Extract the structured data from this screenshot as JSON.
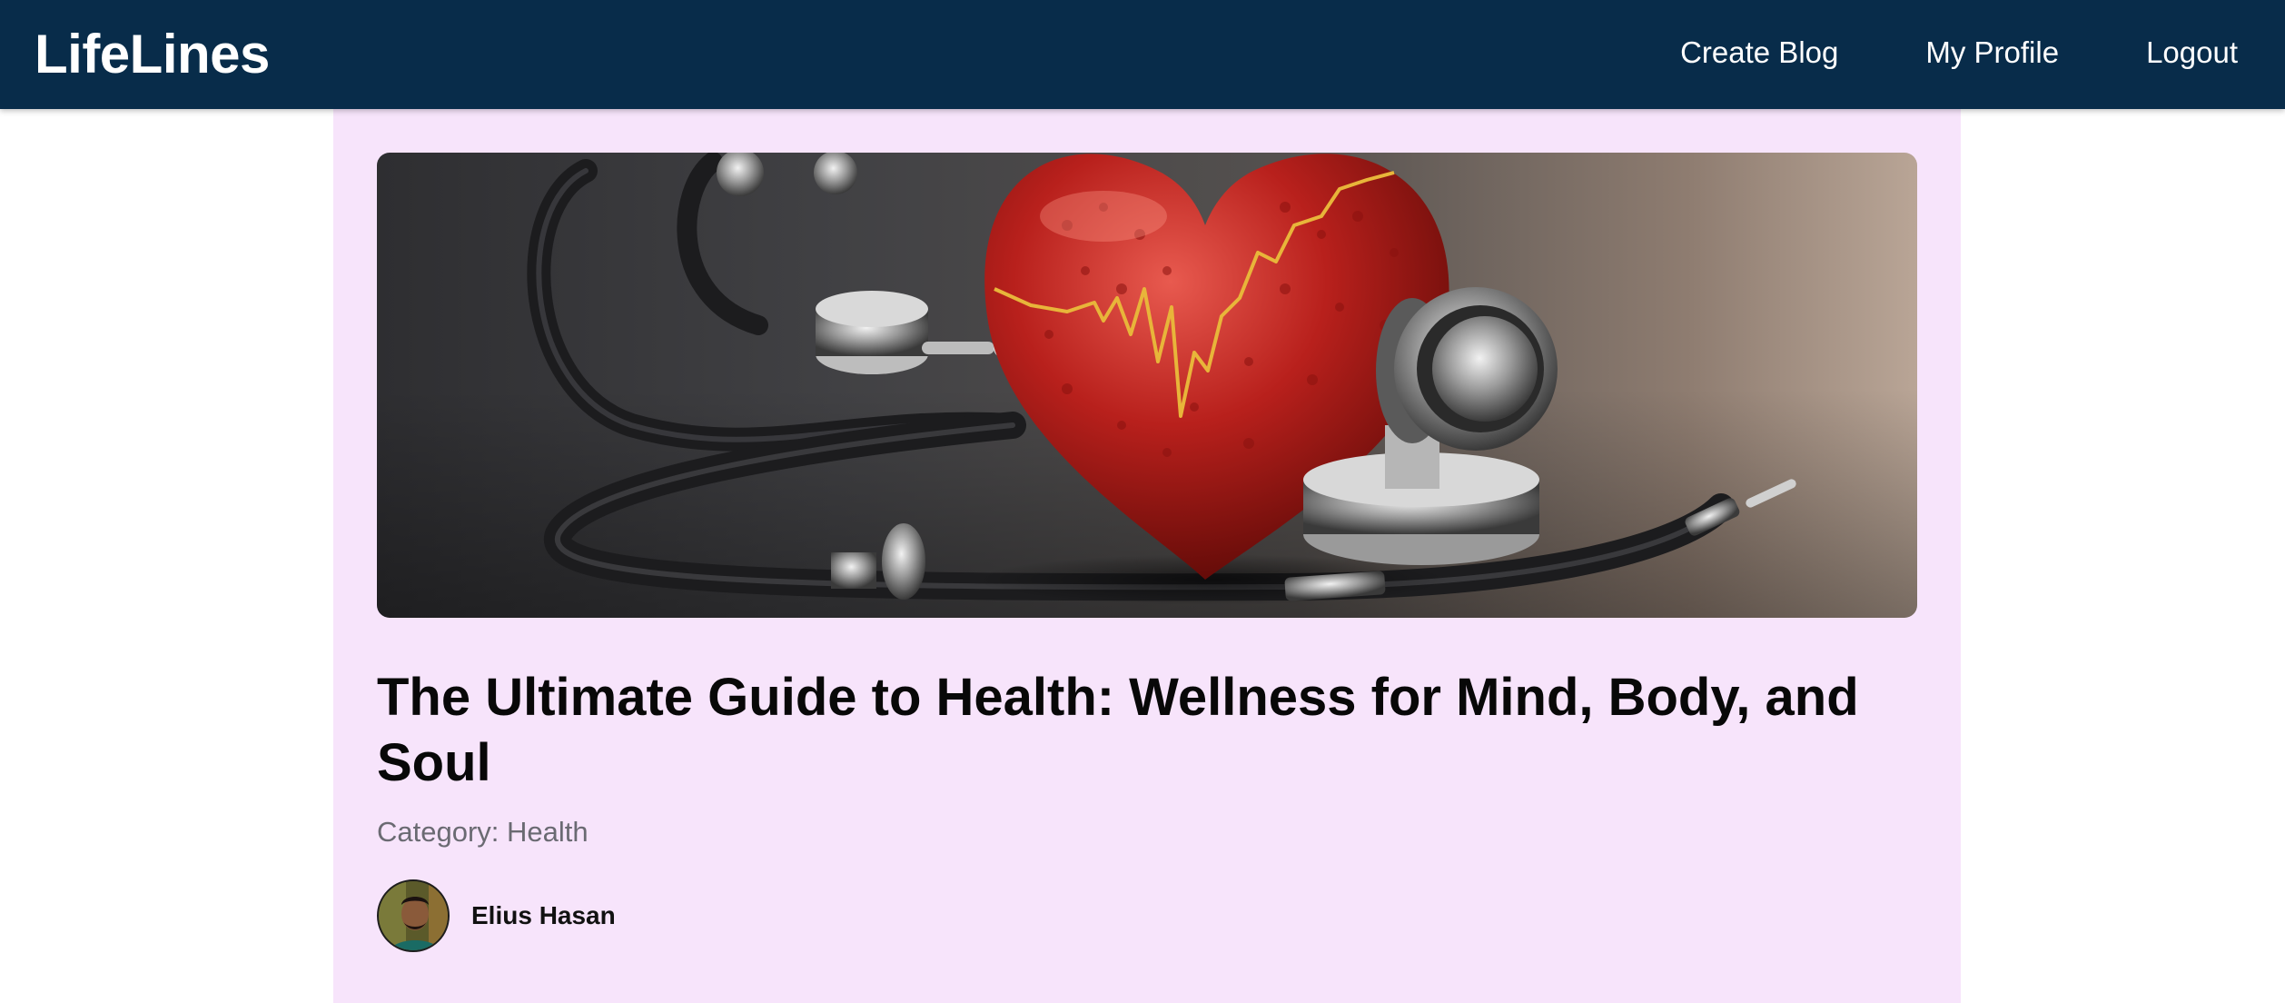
{
  "navbar": {
    "brand": "LifeLines",
    "links": [
      {
        "label": "Create Blog"
      },
      {
        "label": "My Profile"
      },
      {
        "label": "Logout"
      }
    ],
    "background_color": "#082c4a"
  },
  "post": {
    "title": "The Ultimate Guide to Health: Wellness for Mind, Body, and Soul",
    "category_label": "Category:",
    "category_value": "Health",
    "author_name": "Elius Hasan",
    "card_background_color": "#f7e4fb",
    "hero_image_icon": "heart-stethoscope-image",
    "author_avatar_icon": "author-avatar-photo"
  }
}
